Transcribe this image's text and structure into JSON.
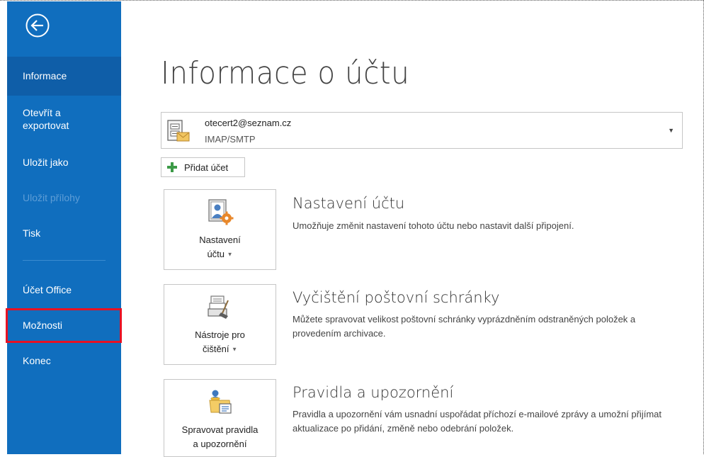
{
  "sidebar": {
    "back_icon": "back-arrow-icon",
    "items": [
      {
        "label": "Informace",
        "state": "active"
      },
      {
        "label": "Otevřít a exportovat",
        "state": "normal"
      },
      {
        "label": "Uložit jako",
        "state": "normal"
      },
      {
        "label": "Uložit přílohy",
        "state": "disabled"
      },
      {
        "label": "Tisk",
        "state": "normal"
      },
      {
        "label": "Účet Office",
        "state": "normal"
      },
      {
        "label": "Možnosti",
        "state": "highlighted"
      },
      {
        "label": "Konec",
        "state": "normal"
      }
    ],
    "colors": {
      "background": "#106ebe",
      "active": "#0f5ea8",
      "highlight_border": "#e81123"
    }
  },
  "main": {
    "title": "Informace o účtu",
    "account": {
      "email": "otecert2@seznam.cz",
      "type": "IMAP/SMTP",
      "icon": "mail-account-icon",
      "dropdown_icon": "dropdown-arrow-icon"
    },
    "add_account": {
      "label": "Přidat účet",
      "icon": "plus-icon"
    },
    "sections": [
      {
        "button_line1": "Nastavení",
        "button_line2": "účtu",
        "icon": "account-settings-icon",
        "title": "Nastavení účtu",
        "description": "Umožňuje změnit nastavení tohoto účtu nebo nastavit další připojení."
      },
      {
        "button_line1": "Nástroje pro",
        "button_line2": "čištění",
        "icon": "cleanup-tools-icon",
        "title": "Vyčištění poštovní schránky",
        "description": "Můžete spravovat velikost poštovní schránky vyprázdněním odstraněných položek a provedením archivace."
      },
      {
        "button_line1": "Spravovat pravidla",
        "button_line2": "a upozornění",
        "icon": "rules-alerts-icon",
        "title": "Pravidla a upozornění",
        "description": "Pravidla a upozornění vám usnadní uspořádat příchozí e-mailové zprávy a umožní přijímat aktualizace po přidání, změně nebo odebrání položek."
      }
    ]
  }
}
